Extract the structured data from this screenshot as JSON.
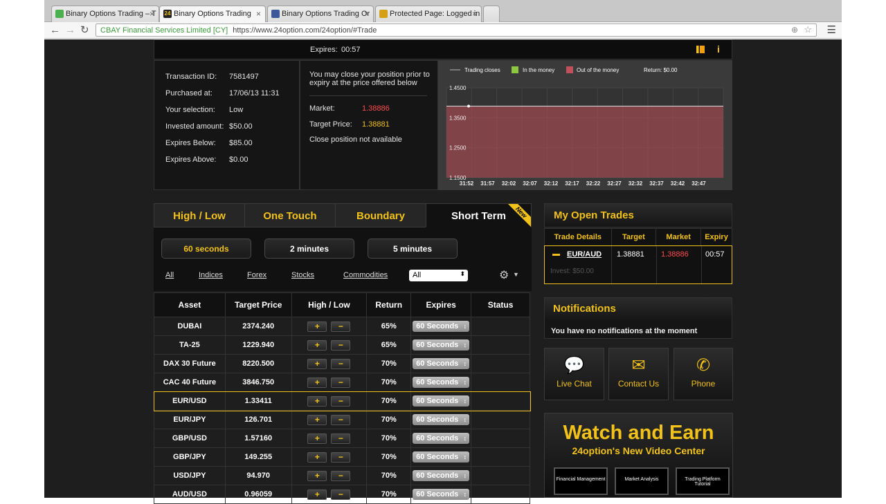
{
  "browser": {
    "tabs": [
      {
        "title": "Binary Options Trading – T",
        "fav": "#4caf50"
      },
      {
        "title": "Binary Options Trading",
        "fav": "#222"
      },
      {
        "title": "Binary Options Trading Or",
        "fav": "#3b5998"
      },
      {
        "title": "Protected Page: Logged in",
        "fav": "#d4a017"
      }
    ],
    "ev_label": "CBAY Financial Services Limited [CY]",
    "url": "https://www.24option.com/24option/#Trade"
  },
  "position": {
    "expires_label": "Expires:",
    "expires_value": "00:57",
    "details": [
      {
        "label": "Transaction ID:",
        "value": "7581497"
      },
      {
        "label": "Purchased at:",
        "value": "17/06/13 11:31"
      },
      {
        "label": "Your selection:",
        "value": "Low"
      },
      {
        "label": "Invested amount:",
        "value": "$50.00"
      },
      {
        "label": "Expires Below:",
        "value": "$85.00"
      },
      {
        "label": "Expires Above:",
        "value": "$0.00"
      }
    ],
    "close_note": "You may close your position prior to expiry at the price offered below",
    "market_label": "Market:",
    "market_value": "1.38886",
    "target_label": "Target Price:",
    "target_value": "1.38881",
    "close_unavailable": "Close position not available"
  },
  "chart_data": {
    "type": "area",
    "legend": [
      "Trading closes",
      "In the money",
      "Out of the money"
    ],
    "return_text": "Return: $0.00",
    "y_ticks": [
      "1.4500",
      "1.3500",
      "1.2500",
      "1.1500"
    ],
    "x_ticks": [
      "31:52",
      "31:57",
      "32:02",
      "32:07",
      "32:12",
      "32:17",
      "32:22",
      "32:27",
      "32:32",
      "32:37",
      "32:42",
      "32:47"
    ],
    "target_level": 1.3888,
    "ylim": [
      1.15,
      1.45
    ],
    "colors": {
      "in_money": "#8dc63f",
      "out_money": "#c0505a"
    }
  },
  "trade_tabs": [
    "High / Low",
    "One Touch",
    "Boundary",
    "Short Term"
  ],
  "new_badge": "New",
  "durations": [
    "60 seconds",
    "2 minutes",
    "5 minutes"
  ],
  "filters": [
    "All",
    "Indices",
    "Forex",
    "Stocks",
    "Commodities"
  ],
  "filter_select": "All",
  "asset_table": {
    "headers": [
      "Asset",
      "Target Price",
      "High / Low",
      "Return",
      "Expires",
      "Status"
    ],
    "rows": [
      {
        "asset": "DUBAI",
        "price": "2374.240",
        "ret": "65%",
        "exp": "60 Seconds"
      },
      {
        "asset": "TA-25",
        "price": "1229.940",
        "ret": "65%",
        "exp": "60 Seconds"
      },
      {
        "asset": "DAX 30 Future",
        "price": "8220.500",
        "ret": "70%",
        "exp": "60 Seconds"
      },
      {
        "asset": "CAC 40 Future",
        "price": "3846.750",
        "ret": "70%",
        "exp": "60 Seconds"
      },
      {
        "asset": "EUR/USD",
        "price": "1.33411",
        "ret": "70%",
        "exp": "60 Seconds"
      },
      {
        "asset": "EUR/JPY",
        "price": "126.701",
        "ret": "70%",
        "exp": "60 Seconds"
      },
      {
        "asset": "GBP/USD",
        "price": "1.57160",
        "ret": "70%",
        "exp": "60 Seconds"
      },
      {
        "asset": "GBP/JPY",
        "price": "149.255",
        "ret": "70%",
        "exp": "60 Seconds"
      },
      {
        "asset": "USD/JPY",
        "price": "94.970",
        "ret": "70%",
        "exp": "60 Seconds"
      },
      {
        "asset": "AUD/USD",
        "price": "0.96059",
        "ret": "70%",
        "exp": "60 Seconds"
      }
    ]
  },
  "open_trades": {
    "title": "My Open Trades",
    "headers": [
      "Trade Details",
      "Target",
      "Market",
      "Expiry"
    ],
    "trade": {
      "asset": "EUR/AUD",
      "invest": "Invest: $50.00",
      "target": "1.38881",
      "market": "1.38886",
      "expiry": "00:57"
    }
  },
  "notifications": {
    "title": "Notifications",
    "text": "You have no notifications at the moment"
  },
  "contact": [
    "Live Chat",
    "Contact Us",
    "Phone"
  ],
  "promo": {
    "headline": "Watch and Earn",
    "sub": "24option's New Video Center",
    "thumbs": [
      "Financial Management",
      "Market Analysis",
      "Trading Platform Tutorial"
    ]
  }
}
